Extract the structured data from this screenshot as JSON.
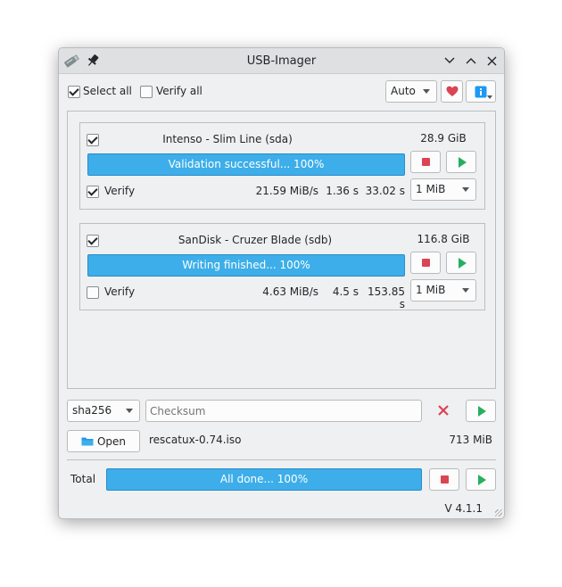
{
  "window": {
    "title": "USB-Imager",
    "version": "V 4.1.1"
  },
  "toolbar": {
    "select_all_label": "Select all",
    "select_all_checked": true,
    "verify_all_label": "Verify all",
    "verify_all_checked": false,
    "mode_value": "Auto"
  },
  "devices": [
    {
      "checked": true,
      "name": "Intenso - Slim Line (sda)",
      "size": "28.9 GiB",
      "status": "Validation successful... 100%",
      "progress": 100,
      "verify_label": "Verify",
      "verify_checked": true,
      "speed": "21.59 MiB/s",
      "time1": "1.36 s",
      "time2": "33.02 s",
      "block_size": "1 MiB"
    },
    {
      "checked": true,
      "name": "SanDisk - Cruzer Blade (sdb)",
      "size": "116.8 GiB",
      "status": "Writing finished... 100%",
      "progress": 100,
      "verify_label": "Verify",
      "verify_checked": false,
      "speed": "4.63 MiB/s",
      "time1": "4.5 s",
      "time2": "153.85 s",
      "block_size": "1 MiB"
    }
  ],
  "checksum": {
    "algorithm": "sha256",
    "placeholder": "Checksum",
    "value": ""
  },
  "file": {
    "open_label": "Open",
    "name": "rescatux-0.74.iso",
    "size": "713 MiB"
  },
  "total": {
    "label": "Total",
    "status": "All done... 100%",
    "progress": 100
  },
  "colors": {
    "accent": "#3daee9",
    "stop": "#da4453",
    "play": "#27ae60",
    "heart": "#da4453",
    "info": "#1d99f3"
  }
}
